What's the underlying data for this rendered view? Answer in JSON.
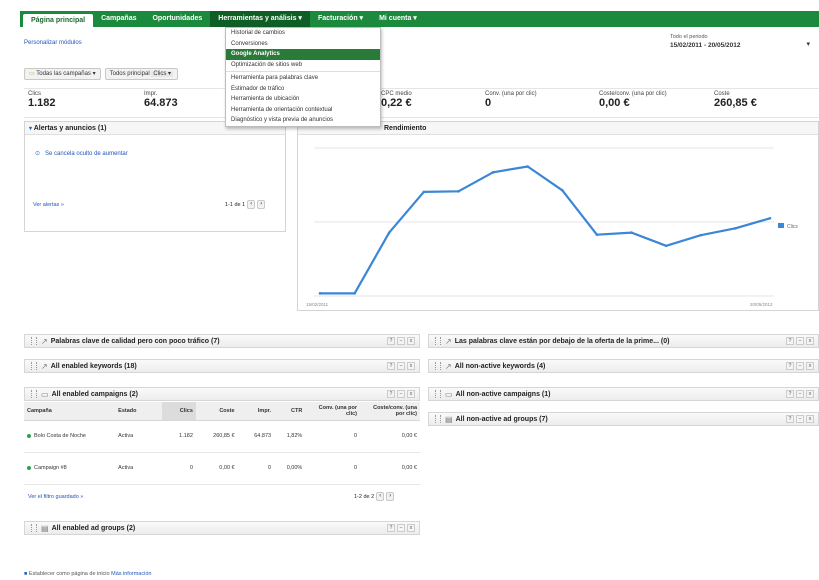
{
  "nav": {
    "tabs": [
      {
        "label": "Página principal",
        "state": "active"
      },
      {
        "label": "Campañas",
        "state": "normal"
      },
      {
        "label": "Oportunidades",
        "state": "normal"
      },
      {
        "label": "Herramientas y análisis ▾",
        "state": "open"
      },
      {
        "label": "Facturación ▾",
        "state": "normal"
      },
      {
        "label": "Mi cuenta ▾",
        "state": "normal"
      }
    ]
  },
  "tools_menu": {
    "items": [
      "Historial de cambios",
      "Conversiones",
      "Google Analytics",
      "Optimización de sitios web",
      "Herramienta para palabras clave",
      "Estimador de tráfico",
      "Herramienta de ubicación",
      "Herramienta de orientación contextual",
      "Diagnóstico y vista previa de anuncios"
    ],
    "highlighted": "Google Analytics"
  },
  "header": {
    "customize_link": "Personalizar módulos",
    "date_label": "Todo el periodo",
    "date_range": "15/02/2011 - 20/05/2012",
    "filter_campaigns": "Todas las campañas ▾",
    "filter_view": "Todos principal",
    "filter_view_extra": "Clics ▾"
  },
  "stats": [
    {
      "label": "Clics",
      "value": "1.182"
    },
    {
      "label": "Impr.",
      "value": "64.873"
    },
    {
      "label": "CPC medio",
      "value": "0,22 €"
    },
    {
      "label": "Conv. (una por clic)",
      "value": "0"
    },
    {
      "label": "Coste/conv. (una por clic)",
      "value": "0,00 €"
    },
    {
      "label": "Coste",
      "value": "260,85 €"
    }
  ],
  "alerts": {
    "title": "Alertas y anuncios (1)",
    "item": "Se cancela oculto de aumentar",
    "view_all": "Ver alertas »",
    "pager": "1-1 de 1"
  },
  "perf": {
    "title": "Rendimiento",
    "legend": "Clics",
    "x_start": "15/02/2011",
    "x_end": "20/05/2012"
  },
  "chart_data": {
    "type": "line",
    "title": "Rendimiento",
    "series": [
      {
        "name": "Clics",
        "values": [
          5,
          5,
          120,
          197,
          198,
          234,
          245,
          200,
          116,
          120,
          95,
          115,
          128,
          147
        ]
      }
    ],
    "ylim": [
      0,
      280
    ],
    "grid": true,
    "legend": "right"
  },
  "modules_left": [
    "Palabras clave de calidad pero con poco tráfico (7)",
    "All enabled keywords (18)",
    "All enabled campaigns (2)",
    "All enabled ad groups (2)"
  ],
  "modules_right": [
    "Las palabras clave están por debajo de la oferta de la prime... (0)",
    "All non-active keywords (4)",
    "All non-active campaigns (1)",
    "All non-active ad groups (7)"
  ],
  "campaign_table": {
    "headers": [
      "Campaña",
      "Estado",
      "Clics",
      "Coste",
      "Impr.",
      "CTR",
      "Conv. (una por clic)",
      "Coste/conv. (una por clic)"
    ],
    "rows": [
      [
        "Bolo Costa de Noche",
        "Activa",
        "1.182",
        "260,85 €",
        "64.873",
        "1,82%",
        "0",
        "0,00 €"
      ],
      [
        "Campaign #8",
        "Activa",
        "0",
        "0,00 €",
        "0",
        "0,00%",
        "0",
        "0,00 €"
      ]
    ],
    "view_all": "Ver el filtro guardado »",
    "pager": "1-2 de 2"
  },
  "footer": {
    "text": "Establecer como página de inicio",
    "link": "Más información"
  },
  "colors": {
    "nav_green": "#1c8a3c",
    "line_blue": "#3b86d6",
    "menu_highlight": "#2a7a3a"
  }
}
